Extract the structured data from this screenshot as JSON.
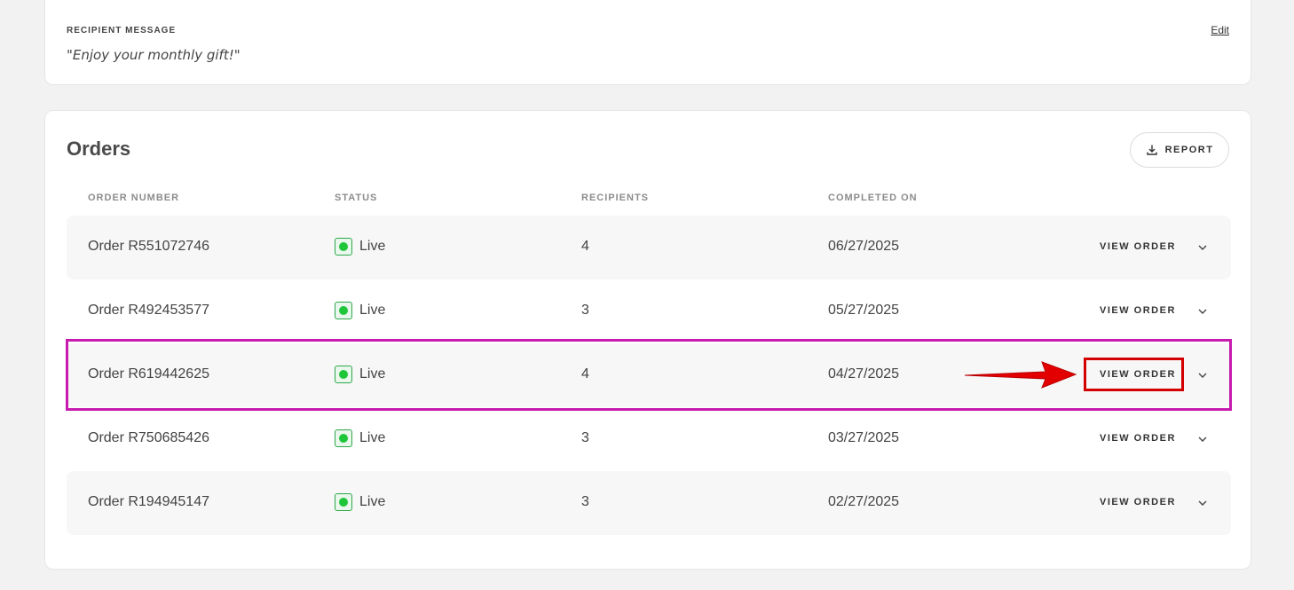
{
  "recipient_message": {
    "label": "RECIPIENT MESSAGE",
    "text": "\"Enjoy your monthly gift!\"",
    "edit_label": "Edit"
  },
  "orders": {
    "title": "Orders",
    "report_label": "REPORT",
    "columns": {
      "order_number": "ORDER NUMBER",
      "status": "STATUS",
      "recipients": "RECIPIENTS",
      "completed_on": "COMPLETED ON"
    },
    "rows": [
      {
        "order": "Order R551072746",
        "status": "Live",
        "recipients": "4",
        "completed": "06/27/2025",
        "action": "VIEW ORDER"
      },
      {
        "order": "Order R492453577",
        "status": "Live",
        "recipients": "3",
        "completed": "05/27/2025",
        "action": "VIEW ORDER"
      },
      {
        "order": "Order R619442625",
        "status": "Live",
        "recipients": "4",
        "completed": "04/27/2025",
        "action": "VIEW ORDER"
      },
      {
        "order": "Order R750685426",
        "status": "Live",
        "recipients": "3",
        "completed": "03/27/2025",
        "action": "VIEW ORDER"
      },
      {
        "order": "Order R194945147",
        "status": "Live",
        "recipients": "3",
        "completed": "02/27/2025",
        "action": "VIEW ORDER"
      }
    ]
  },
  "colors": {
    "live_green": "#1fc63a",
    "highlight_magenta": "#c71aae",
    "annotation_red": "#d40000"
  }
}
